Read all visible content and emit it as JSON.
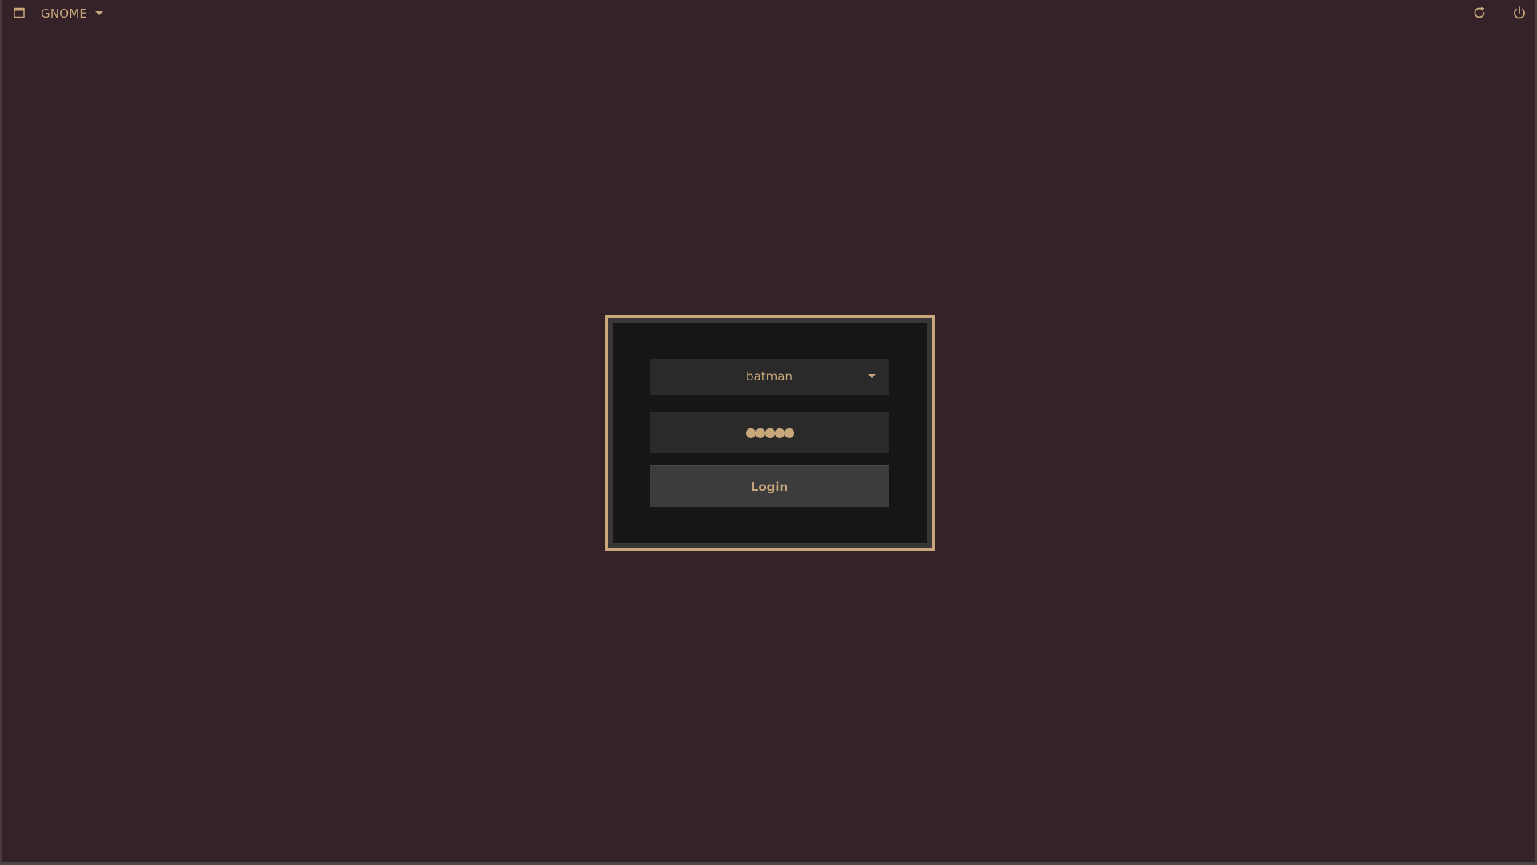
{
  "topbar": {
    "session_label": "GNOME",
    "session_icon": "window-icon",
    "caret_icon": "caret-down-icon",
    "reboot_icon": "reboot-icon",
    "power_icon": "power-icon"
  },
  "login": {
    "username": "batman",
    "password_mask": "●●●●●",
    "login_label": "Login"
  },
  "colors": {
    "background": "#342228",
    "accent": "#c8a77a",
    "panel": "#161616",
    "field": "#2a2a2a",
    "button": "#3c3c3e"
  }
}
